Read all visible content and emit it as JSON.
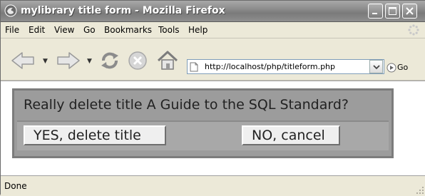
{
  "window": {
    "title": "mylibrary title form - Mozilla Firefox"
  },
  "menubar": {
    "items": [
      {
        "label": "File"
      },
      {
        "label": "Edit"
      },
      {
        "label": "View"
      },
      {
        "label": "Go"
      },
      {
        "label": "Bookmarks"
      },
      {
        "label": "Tools"
      },
      {
        "label": "Help"
      }
    ]
  },
  "toolbar": {
    "url": "http://localhost/php/titleform.php",
    "go_label": "Go"
  },
  "dialog": {
    "question": "Really delete title A Guide to the SQL Standard?",
    "confirm_label": "YES, delete title",
    "cancel_label": "NO, cancel"
  },
  "status": {
    "text": "Done"
  }
}
